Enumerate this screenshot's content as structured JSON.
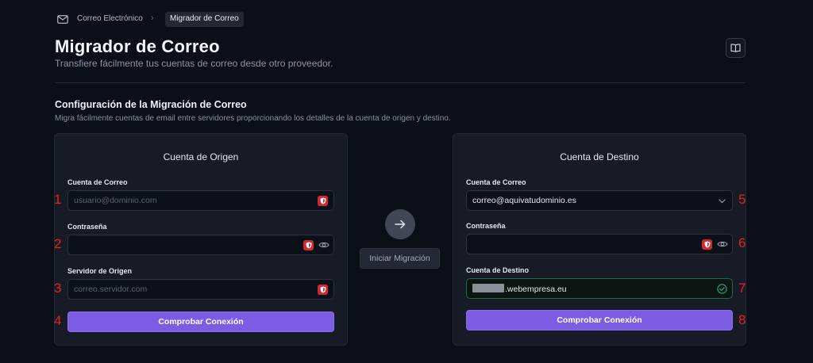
{
  "breadcrumb": {
    "icon": "mail-icon",
    "items": [
      "Correo Electrónico",
      "Migrador de Correo"
    ],
    "separator": "›"
  },
  "header": {
    "title": "Migrador de Correo",
    "subtitle": "Transfiere fácilmente tus cuentas de correo desde otro proveedor.",
    "help_icon": "book-icon"
  },
  "section": {
    "title": "Configuración de la Migración de Correo",
    "description": "Migra fácilmente cuentas de email entre servidores proporcionando los detalles de la cuenta de origen y destino."
  },
  "source": {
    "title": "Cuenta de Origen",
    "email_label": "Cuenta de Correo",
    "email_placeholder": "usuario@dominio.com",
    "password_label": "Contraseña",
    "password_value": "",
    "server_label": "Servidor de Origen",
    "server_placeholder": "correo.servidor.com",
    "check_button": "Comprobar Conexión"
  },
  "destination": {
    "title": "Cuenta de Destino",
    "email_label": "Cuenta de Correo",
    "email_value": "correo@aquivatudominio.es",
    "password_label": "Contraseña",
    "password_value": "",
    "dest_label": "Cuenta de Destino",
    "dest_value_suffix": ".webempresa.eu",
    "check_button": "Comprobar Conexión"
  },
  "middle": {
    "arrow_icon": "arrow-right-icon",
    "start_button": "Iniciar Migración"
  },
  "annotations": [
    "1",
    "2",
    "3",
    "4",
    "5",
    "6",
    "7",
    "8"
  ],
  "colors": {
    "background": "#0b0f18",
    "panel": "#161b26",
    "accent": "#7c5ce3",
    "annotation": "#e0261e",
    "shield": "#d12a36",
    "success": "#22a06b"
  }
}
